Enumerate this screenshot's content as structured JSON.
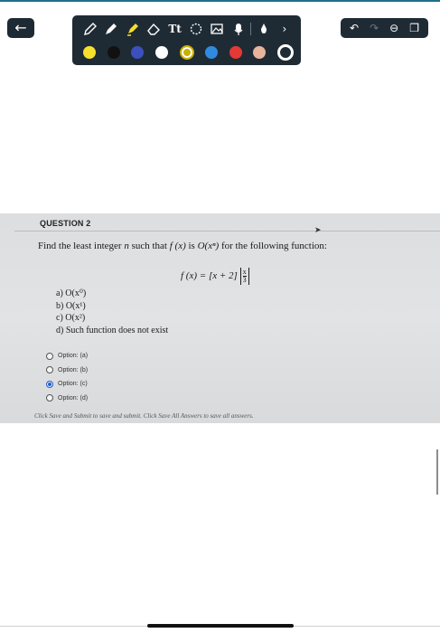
{
  "nav": {
    "back_icon": "arrow-left-icon",
    "back_glyph": "←"
  },
  "toolbar": {
    "tools": [
      "pencil-icon",
      "pen-icon",
      "highlighter-icon",
      "eraser-icon",
      "text-tool-icon",
      "shapes-icon",
      "image-icon",
      "record-icon",
      "dropper-icon"
    ],
    "text_tool_label": "Tt",
    "more_glyph": "›",
    "colors": [
      {
        "name": "yellow",
        "hex": "#f6e02b"
      },
      {
        "name": "black",
        "hex": "#111111"
      },
      {
        "name": "indigo",
        "hex": "#3b4fbf"
      },
      {
        "name": "white",
        "hex": "#ffffff"
      },
      {
        "name": "olive-yellow",
        "hex": "#c9b000",
        "selected": true
      },
      {
        "name": "blue",
        "hex": "#2f8be0"
      },
      {
        "name": "red",
        "hex": "#e53935"
      },
      {
        "name": "peach",
        "hex": "#e8b49a"
      },
      {
        "name": "dark-teal",
        "hex": "#1f2b34",
        "ring": true
      }
    ]
  },
  "right_tools": {
    "undo_glyph": "↶",
    "redo_glyph": "↷",
    "minus_glyph": "⊖",
    "copy_glyph": "❐"
  },
  "question": {
    "title": "QUESTION 2",
    "prompt_prefix": "Find the least integer ",
    "prompt_var": "n",
    "prompt_mid": " such that ",
    "prompt_func": "f (x)",
    "prompt_is": " is ",
    "prompt_bigo": "O(xⁿ)",
    "prompt_suffix": " for the following function:",
    "formula_left": "f (x) = [x + 2] ",
    "formula_num": "x",
    "formula_den": "3",
    "choices": [
      "a)  O(x⁰)",
      "b)  O(x¹)",
      "c)  O(x²)",
      "d)  Such function does not exist"
    ],
    "options": [
      {
        "label": "Option: (a)",
        "checked": false
      },
      {
        "label": "Option: (b)",
        "checked": false
      },
      {
        "label": "Option: (c)",
        "checked": true
      },
      {
        "label": "Option: (d)",
        "checked": false
      }
    ],
    "footer": "Click Save and Submit to save and submit. Click Save All Answers to save all answers."
  }
}
